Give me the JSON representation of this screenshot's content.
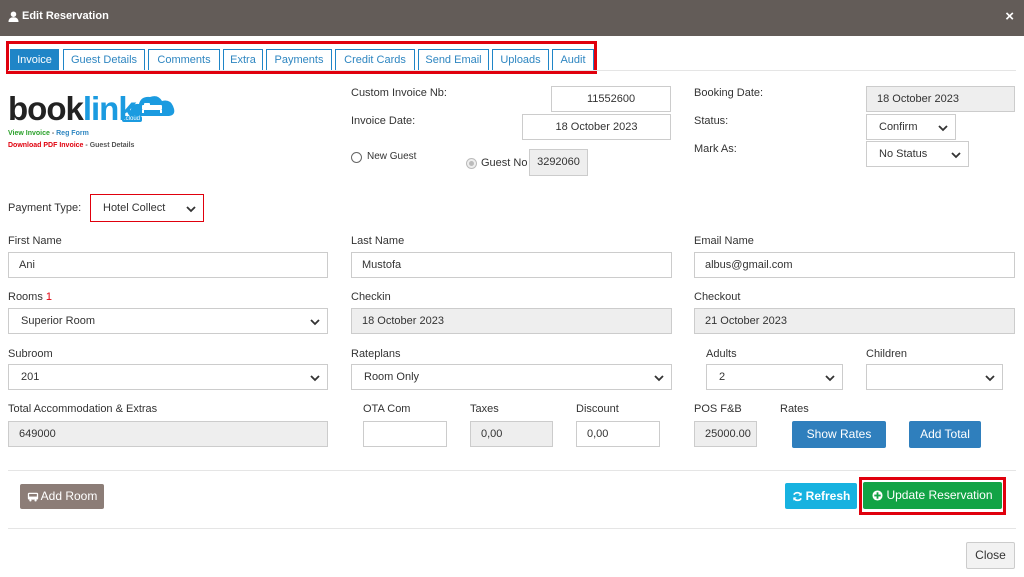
{
  "window": {
    "title": "Edit Reservation",
    "close_icon": "×"
  },
  "tabs": [
    {
      "label": "Invoice",
      "active": true
    },
    {
      "label": "Guest Details"
    },
    {
      "label": "Comments"
    },
    {
      "label": "Extra"
    },
    {
      "label": "Payments"
    },
    {
      "label": "Credit Cards"
    },
    {
      "label": "Send Email"
    },
    {
      "label": "Uploads"
    },
    {
      "label": "Audit"
    }
  ],
  "logo": {
    "part1": "book",
    "part2": "link",
    "sub": ".cloud"
  },
  "links": {
    "view_invoice": "View Invoice",
    "sep1": " - ",
    "reg_form": "Reg Form",
    "download_pdf": "Download PDF Invoice",
    "sep2": " - ",
    "guest_details": "Guest Details"
  },
  "invoice": {
    "custom_invoice_label": "Custom Invoice Nb:",
    "custom_invoice_value": "11552600",
    "invoice_date_label": "Invoice Date:",
    "invoice_date_value": "18 October 2023",
    "new_guest_label": "New Guest",
    "guest_no_label": "Guest No",
    "guest_no_value": "3292060"
  },
  "booking": {
    "booking_date_label": "Booking Date:",
    "booking_date_value": "18 October 2023",
    "status_label": "Status:",
    "status_value": "Confirm",
    "mark_as_label": "Mark As:",
    "mark_as_value": "No Status"
  },
  "payment_type": {
    "label": "Payment Type:",
    "value": "Hotel Collect"
  },
  "guest": {
    "first_name_label": "First Name",
    "first_name_value": "Ani",
    "last_name_label": "Last Name",
    "last_name_value": "Mustofa",
    "email_label": "Email Name",
    "email_value": "albus@gmail.com"
  },
  "room": {
    "rooms_label": "Rooms",
    "rooms_required": "1",
    "rooms_value": "Superior Room",
    "checkin_label": "Checkin",
    "checkin_value": "18 October 2023",
    "checkout_label": "Checkout",
    "checkout_value": "21 October 2023",
    "subroom_label": "Subroom",
    "subroom_value": "201",
    "rateplans_label": "Rateplans",
    "rateplans_value": "Room Only",
    "adults_label": "Adults",
    "adults_value": "2",
    "children_label": "Children",
    "children_value": ""
  },
  "totals": {
    "total_label": "Total Accommodation & Extras",
    "total_value": "649000",
    "ota_label": "OTA Com",
    "ota_value": "",
    "taxes_label": "Taxes",
    "taxes_value": "0,00",
    "discount_label": "Discount",
    "discount_value": "0,00",
    "pos_label": "POS F&B",
    "pos_value": "25000.00",
    "rates_label": "Rates",
    "show_rates_button": "Show Rates",
    "add_total_button": "Add Total"
  },
  "footer": {
    "add_room_button": "Add Room",
    "refresh_button": "Refresh",
    "update_button": "Update Reservation",
    "close_button": "Close"
  },
  "colors": {
    "titlebar": "#635c58",
    "tab_blue": "#1f85c7",
    "highlight_red": "#e0000d",
    "update_green": "#12a345",
    "refresh_cyan": "#17b2e0",
    "show_rates_blue": "#2f7fbd",
    "add_room_grey": "#8c7d77"
  }
}
